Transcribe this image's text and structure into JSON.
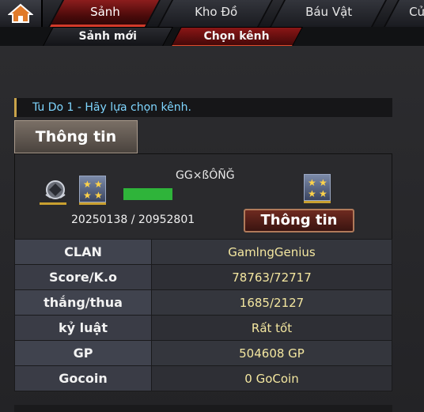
{
  "top_tabs": [
    {
      "label": "Sảnh",
      "active": true
    },
    {
      "label": "Kho Đồ",
      "active": false
    },
    {
      "label": "Báu Vật",
      "active": false
    },
    {
      "label": "Cửa",
      "active": false
    }
  ],
  "sub_tabs": [
    {
      "label": "Sảnh mới",
      "active": false
    },
    {
      "label": "Chọn kênh",
      "active": true
    }
  ],
  "notice": "Tu Do 1 - Hãy lựa chọn kênh.",
  "info_tab_label": "Thông tin",
  "player": {
    "name": "GG×ßÔÑĞ",
    "exp_text": "20250138 / 20952801",
    "info_button": "Thông tin"
  },
  "stats": [
    {
      "label": "CLAN",
      "value": "GamlngGenius"
    },
    {
      "label": "Score/K.o",
      "value": "78763/72717"
    },
    {
      "label": "thắng/thua",
      "value": "1685/2127"
    },
    {
      "label": "kỷ luật",
      "value": "Rất tốt"
    },
    {
      "label": "GP",
      "value": "504608 GP"
    },
    {
      "label": "Gocoin",
      "value": "0 GoCoin"
    }
  ],
  "colors": {
    "accent_red": "#8c1d1d",
    "notice_text": "#7fd6ff",
    "value_text": "#f4e7a0",
    "hp_green": "#2fb43a"
  },
  "icons": [
    "home-icon",
    "rank-badge-icon",
    "rank-stars-icon"
  ]
}
